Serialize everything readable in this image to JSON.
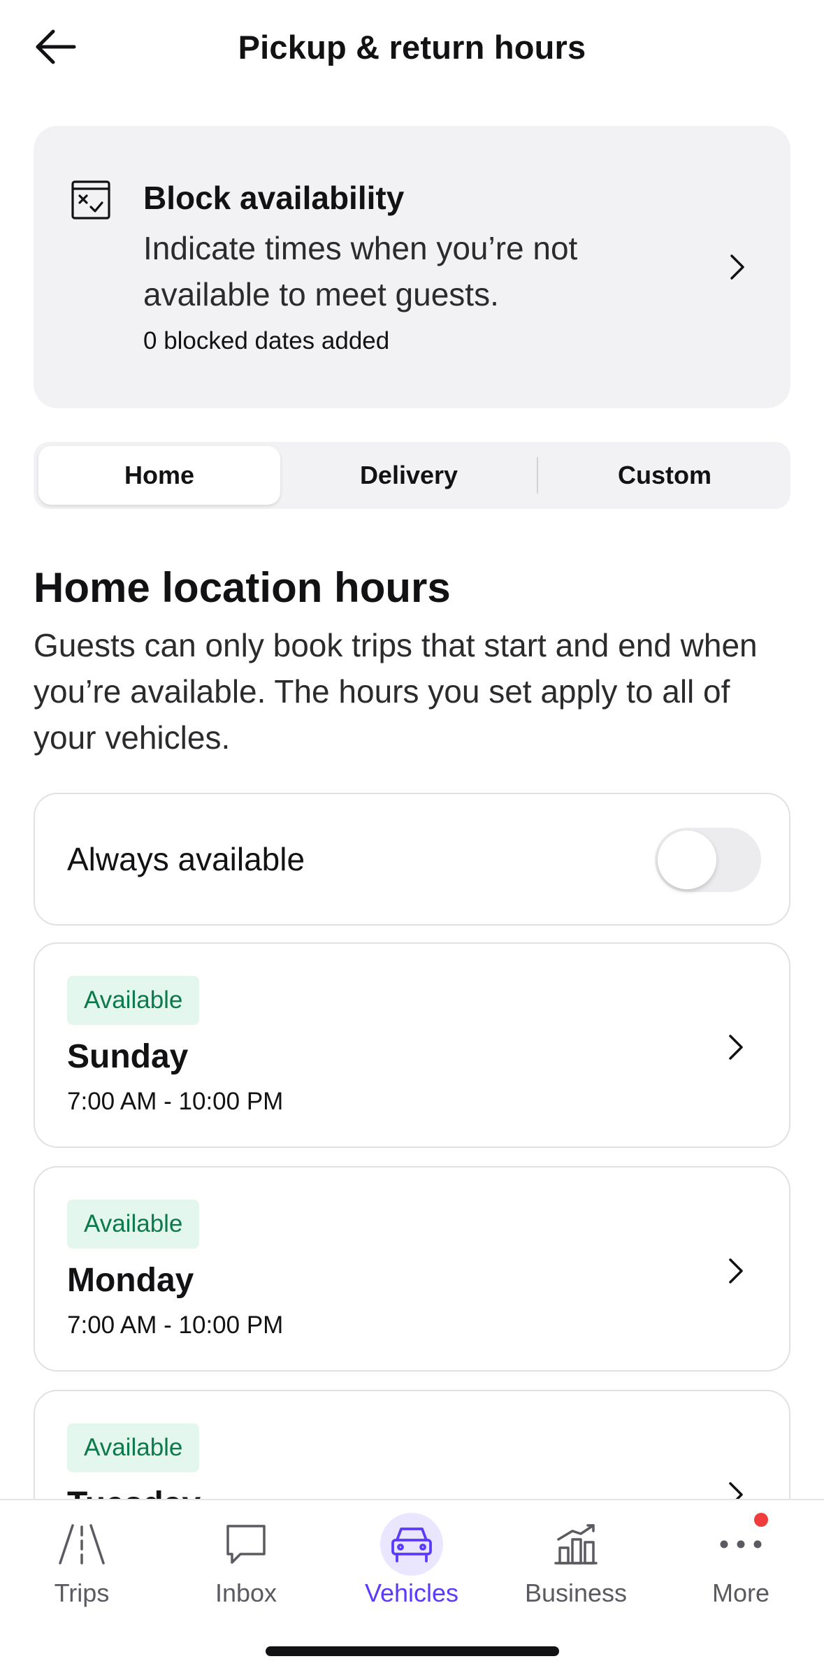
{
  "header": {
    "title": "Pickup & return hours"
  },
  "block_card": {
    "title": "Block availability",
    "description": "Indicate times when you’re not available to meet guests.",
    "count": "0 blocked dates added"
  },
  "tabs": [
    {
      "label": "Home",
      "selected": true
    },
    {
      "label": "Delivery",
      "selected": false
    },
    {
      "label": "Custom",
      "selected": false
    }
  ],
  "section": {
    "title": "Home location hours",
    "description": "Guests can only book trips that start and end when you’re available. The hours you set apply to all of your vehicles."
  },
  "always_available": {
    "label": "Always available",
    "on": false
  },
  "days": [
    {
      "status": "Available",
      "name": "Sunday",
      "hours": "7:00 AM - 10:00 PM"
    },
    {
      "status": "Available",
      "name": "Monday",
      "hours": "7:00 AM - 10:00 PM"
    },
    {
      "status": "Available",
      "name": "Tuesday",
      "hours": ""
    }
  ],
  "bottom_nav": [
    {
      "label": "Trips",
      "icon": "road-icon"
    },
    {
      "label": "Inbox",
      "icon": "chat-bubble-icon"
    },
    {
      "label": "Vehicles",
      "icon": "car-icon",
      "active": true
    },
    {
      "label": "Business",
      "icon": "bar-chart-icon"
    },
    {
      "label": "More",
      "icon": "more-dots-icon",
      "notification": true
    }
  ],
  "colors": {
    "accent": "#593cfb",
    "badge_bg": "#e3f7ee",
    "badge_text": "#0c7a4a",
    "card_bg": "#f2f2f4",
    "notification": "#f03c3c"
  }
}
